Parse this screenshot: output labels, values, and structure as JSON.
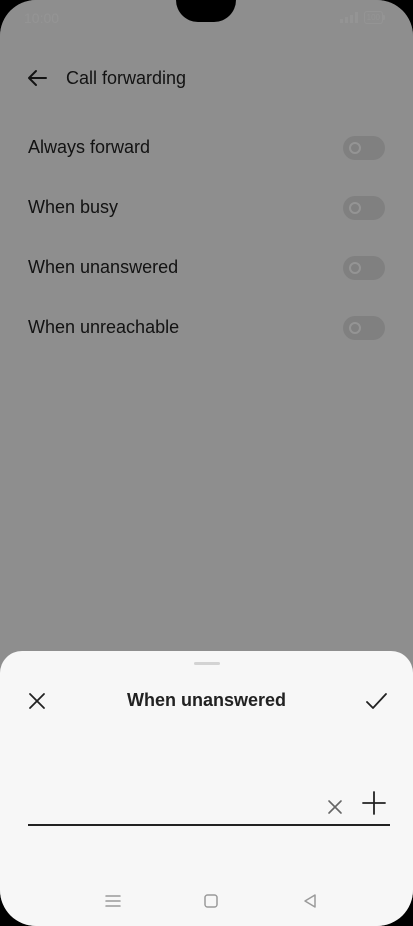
{
  "status_bar": {
    "time": "10:00",
    "battery": "100"
  },
  "header": {
    "title": "Call forwarding"
  },
  "settings": [
    {
      "label": "Always forward",
      "enabled": false
    },
    {
      "label": "When busy",
      "enabled": false
    },
    {
      "label": "When unanswered",
      "enabled": false
    },
    {
      "label": "When unreachable",
      "enabled": false
    }
  ],
  "sheet": {
    "title": "When unanswered",
    "number_value": "",
    "number_placeholder": ""
  },
  "icons": {
    "back": "arrow-left-icon",
    "close": "close-icon",
    "confirm": "checkmark-icon",
    "clear": "clear-icon",
    "add": "plus-icon",
    "nav": [
      "menu-icon",
      "home-icon",
      "back-triangle-icon"
    ]
  },
  "colors": {
    "text": "#222222",
    "background": "#f5f5f5",
    "toggle_off": "#dcdcdc",
    "scrim": "#00000069"
  }
}
